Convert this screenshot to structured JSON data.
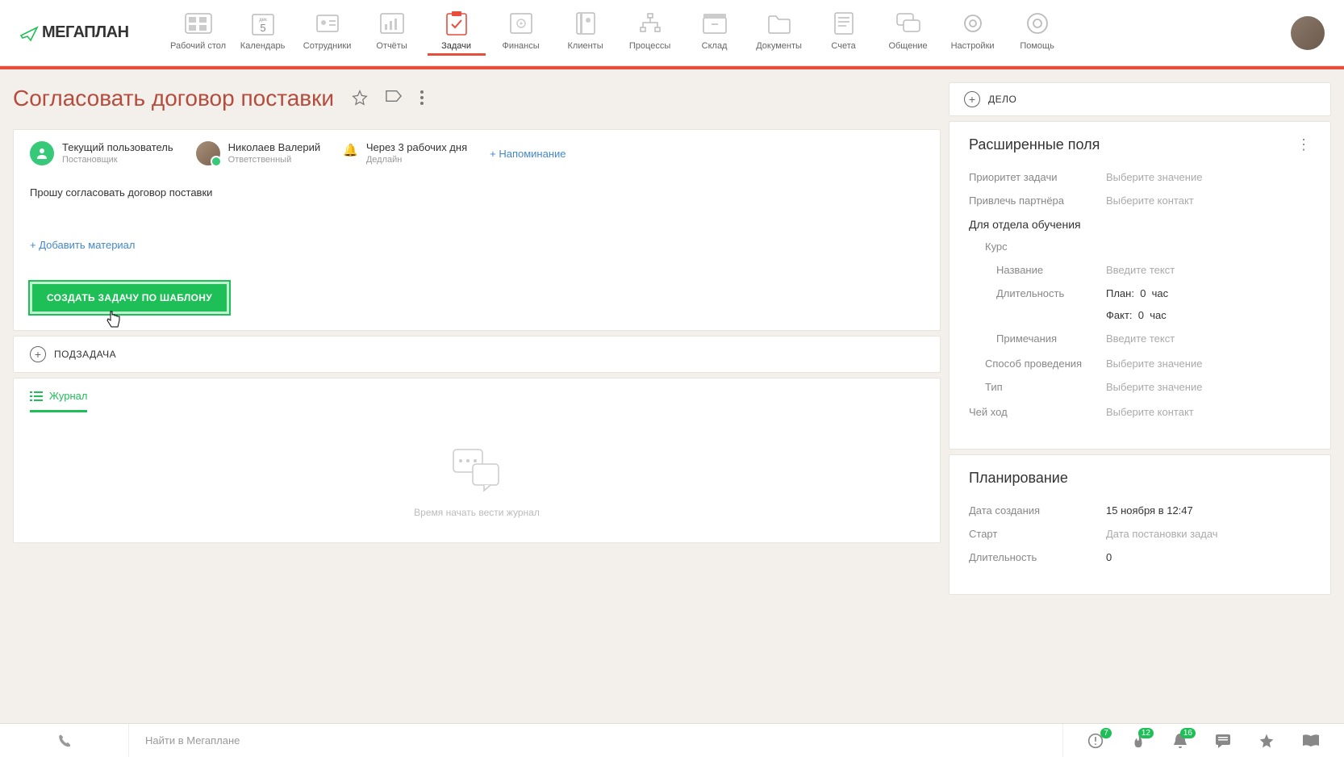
{
  "logo": "мегаплан",
  "nav": [
    {
      "label": "Рабочий стол"
    },
    {
      "label": "Календарь"
    },
    {
      "label": "Сотрудники"
    },
    {
      "label": "Отчёты"
    },
    {
      "label": "Задачи"
    },
    {
      "label": "Финансы"
    },
    {
      "label": "Клиенты"
    },
    {
      "label": "Процессы"
    },
    {
      "label": "Склад"
    },
    {
      "label": "Документы"
    },
    {
      "label": "Счета"
    },
    {
      "label": "Общение"
    },
    {
      "label": "Настройки"
    },
    {
      "label": "Помощь"
    }
  ],
  "calendar_badge": {
    "month": "дек",
    "day": "5"
  },
  "page_title": "Согласовать договор поставки",
  "meta": {
    "owner": {
      "name": "Текущий пользователь",
      "role": "Постановщик"
    },
    "responsible": {
      "name": "Николаев Валерий",
      "role": "Ответственный"
    },
    "deadline": {
      "value": "Через 3 рабочих дня",
      "role": "Дедлайн"
    },
    "reminder_link": "+ Напоминание"
  },
  "description": "Прошу согласовать договор поставки",
  "add_material": "+ Добавить материал",
  "create_button": "СОЗДАТЬ ЗАДАЧУ ПО ШАБЛОНУ",
  "subtask": "ПОДЗАДАЧА",
  "journal_tab": "Журнал",
  "journal_empty": "Время начать вести журнал",
  "delo": "ДЕЛО",
  "ext": {
    "title": "Расширенные поля",
    "priority": {
      "label": "Приоритет задачи",
      "ph": "Выберите значение"
    },
    "partner": {
      "label": "Привлечь партнёра",
      "ph": "Выберите контакт"
    },
    "section": "Для отдела обучения",
    "course_label": "Курс",
    "name": {
      "label": "Название",
      "ph": "Введите текст"
    },
    "duration": {
      "label": "Длительность"
    },
    "plan_line": {
      "prefix": "План:",
      "val": "0",
      "unit": "час"
    },
    "fact_line": {
      "prefix": "Факт:",
      "val": "0",
      "unit": "час"
    },
    "notes": {
      "label": "Примечания",
      "ph": "Введите текст"
    },
    "method": {
      "label": "Способ проведения",
      "ph": "Выберите значение"
    },
    "type": {
      "label": "Тип",
      "ph": "Выберите значение"
    },
    "turn": {
      "label": "Чей ход",
      "ph": "Выберите контакт"
    }
  },
  "planning": {
    "title": "Планирование",
    "created": {
      "label": "Дата создания",
      "value": "15 ноября в 12:47"
    },
    "start": {
      "label": "Старт",
      "ph": "Дата постановки задач"
    },
    "duration": {
      "label": "Длительность",
      "value": "0"
    }
  },
  "bottombar": {
    "search_ph": "Найти в Мегаплане",
    "badges": {
      "clock": "7",
      "fire": "12",
      "bell": "16"
    }
  }
}
